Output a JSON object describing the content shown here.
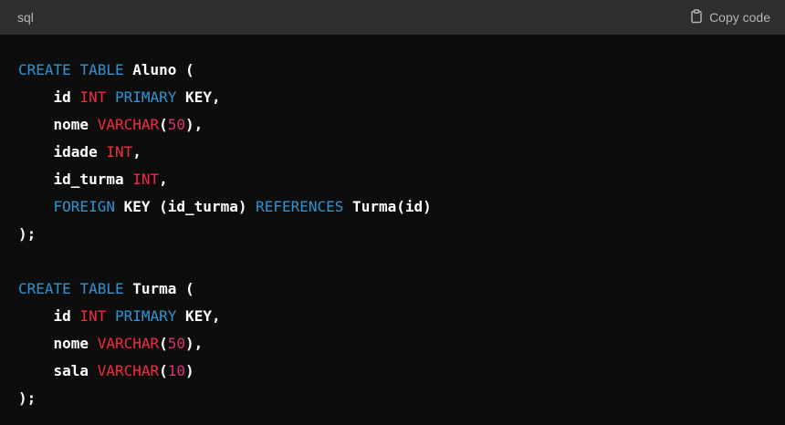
{
  "header": {
    "language": "sql",
    "copy_label": "Copy code"
  },
  "code": {
    "lines": [
      [
        [
          "kw-blue",
          "CREATE"
        ],
        [
          "ident",
          " "
        ],
        [
          "kw-blue",
          "TABLE"
        ],
        [
          "ident",
          " Aluno ("
        ]
      ],
      [
        [
          "ident",
          "    id "
        ],
        [
          "kw-red",
          "INT"
        ],
        [
          "ident",
          " "
        ],
        [
          "kw-blue",
          "PRIMARY"
        ],
        [
          "ident",
          " KEY,"
        ]
      ],
      [
        [
          "ident",
          "    nome "
        ],
        [
          "kw-red",
          "VARCHAR"
        ],
        [
          "ident",
          "("
        ],
        [
          "num",
          "50"
        ],
        [
          "ident",
          "),"
        ]
      ],
      [
        [
          "ident",
          "    idade "
        ],
        [
          "kw-red",
          "INT"
        ],
        [
          "ident",
          ","
        ]
      ],
      [
        [
          "ident",
          "    id_turma "
        ],
        [
          "kw-red",
          "INT"
        ],
        [
          "ident",
          ","
        ]
      ],
      [
        [
          "ident",
          "    "
        ],
        [
          "kw-blue",
          "FOREIGN"
        ],
        [
          "ident",
          " KEY (id_turma) "
        ],
        [
          "kw-blue",
          "REFERENCES"
        ],
        [
          "ident",
          " Turma(id)"
        ]
      ],
      [
        [
          "ident",
          ");"
        ]
      ],
      [
        [
          "ident",
          ""
        ]
      ],
      [
        [
          "kw-blue",
          "CREATE"
        ],
        [
          "ident",
          " "
        ],
        [
          "kw-blue",
          "TABLE"
        ],
        [
          "ident",
          " Turma ("
        ]
      ],
      [
        [
          "ident",
          "    id "
        ],
        [
          "kw-red",
          "INT"
        ],
        [
          "ident",
          " "
        ],
        [
          "kw-blue",
          "PRIMARY"
        ],
        [
          "ident",
          " KEY,"
        ]
      ],
      [
        [
          "ident",
          "    nome "
        ],
        [
          "kw-red",
          "VARCHAR"
        ],
        [
          "ident",
          "("
        ],
        [
          "num",
          "50"
        ],
        [
          "ident",
          "),"
        ]
      ],
      [
        [
          "ident",
          "    sala "
        ],
        [
          "kw-red",
          "VARCHAR"
        ],
        [
          "ident",
          "("
        ],
        [
          "num",
          "10"
        ],
        [
          "ident",
          ")"
        ]
      ],
      [
        [
          "ident",
          ");"
        ]
      ]
    ]
  },
  "icons": {
    "copy": "clipboard-icon"
  }
}
